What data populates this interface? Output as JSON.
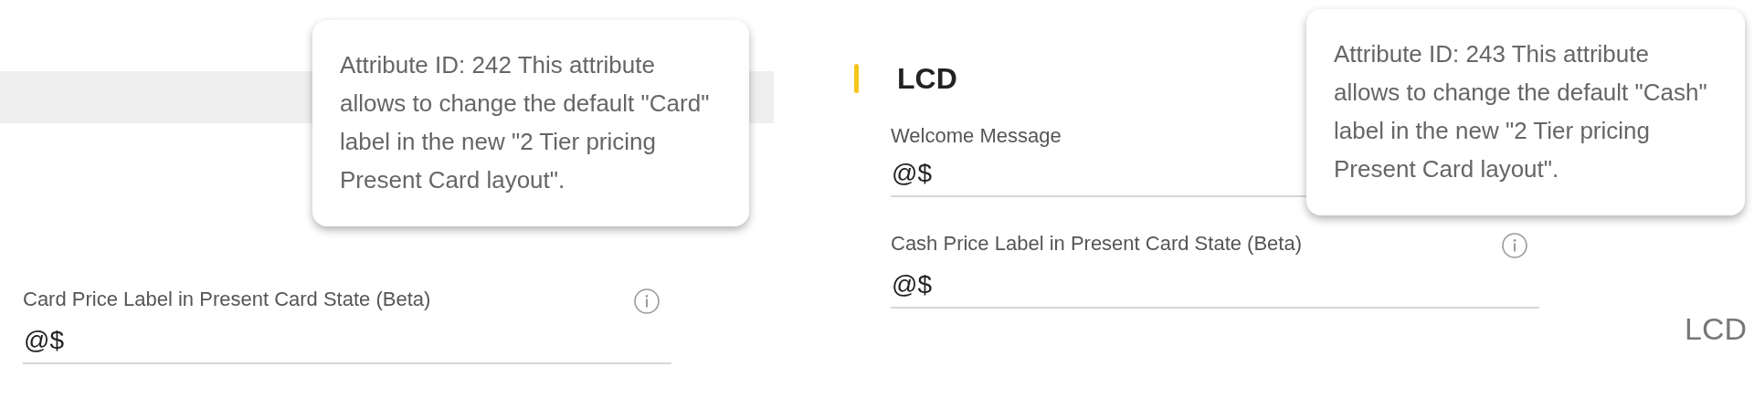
{
  "left_panel": {
    "fields": [
      {
        "label": "Card Price Label in Present Card State (Beta)",
        "value": "@$",
        "info": true
      }
    ]
  },
  "lcd_section": {
    "title": "LCD",
    "fields": [
      {
        "label": "Welcome Message",
        "value": "@$",
        "info": false
      },
      {
        "label": "Cash Price Label in Present Card State (Beta)",
        "value": "@$",
        "info": true
      }
    ]
  },
  "side_label": "LCD",
  "tooltips": [
    {
      "text": "Attribute ID: 242 This attribute allows to change the default \"Card\" label in the new \"2 Tier pricing Present Card layout\"."
    },
    {
      "text": "Attribute ID: 243 This attribute allows to change the default \"Cash\" label in the new \"2 Tier pricing Present Card layout\"."
    }
  ]
}
